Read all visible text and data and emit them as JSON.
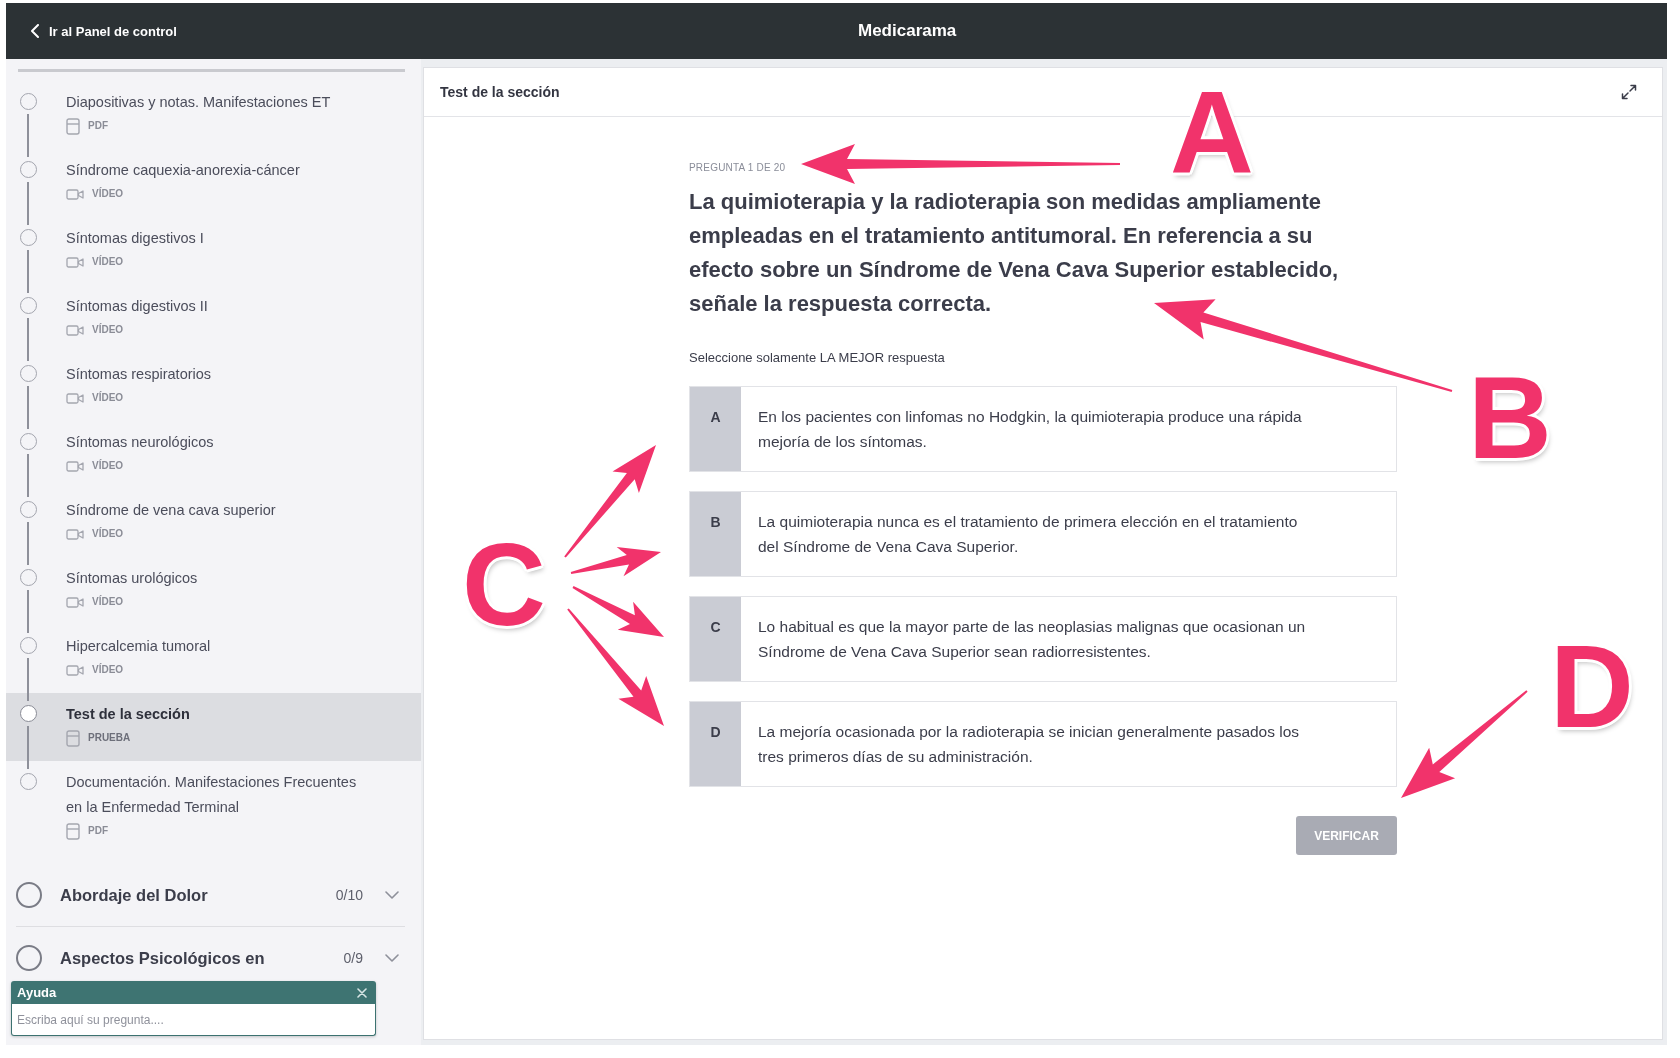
{
  "top_bar": {
    "back_link": "Ir al Panel de control",
    "title": "Medicarama"
  },
  "sidebar": {
    "items": [
      {
        "title": "Diapositivas y notas. Manifestaciones ET",
        "type_label": "PDF",
        "kind": "document",
        "selected": false
      },
      {
        "title": "Síndrome caquexia-anorexia-cáncer",
        "type_label": "VÍDEO",
        "kind": "video",
        "selected": false
      },
      {
        "title": "Síntomas digestivos I",
        "type_label": "VÍDEO",
        "kind": "video",
        "selected": false
      },
      {
        "title": "Síntomas digestivos II",
        "type_label": "VÍDEO",
        "kind": "video",
        "selected": false
      },
      {
        "title": "Síntomas respiratorios",
        "type_label": "VÍDEO",
        "kind": "video",
        "selected": false
      },
      {
        "title": "Síntomas neurológicos",
        "type_label": "VÍDEO",
        "kind": "video",
        "selected": false
      },
      {
        "title": "Síndrome de vena cava superior",
        "type_label": "VÍDEO",
        "kind": "video",
        "selected": false
      },
      {
        "title": "Síntomas urológicos",
        "type_label": "VÍDEO",
        "kind": "video",
        "selected": false
      },
      {
        "title": "Hipercalcemia tumoral",
        "type_label": "VÍDEO",
        "kind": "video",
        "selected": false
      },
      {
        "title": "Test de la sección",
        "type_label": "PRUEBA",
        "kind": "document",
        "selected": true
      },
      {
        "title": "Documentación. Manifestaciones Frecuentes en la Enfermedad Terminal",
        "type_label": "PDF",
        "kind": "document",
        "selected": false
      }
    ],
    "sections": [
      {
        "title": "Abordaje del Dolor",
        "count": "0/10",
        "expanded": false
      },
      {
        "title": "Aspectos Psicológicos en",
        "count": "0/9",
        "expanded": false
      }
    ]
  },
  "help_widget": {
    "title": "Ayuda",
    "placeholder": "Escriba aquí su pregunta...."
  },
  "panel": {
    "title": "Test de la sección",
    "question": {
      "progress": "PREGUNTA 1 DE 20",
      "text": "La quimioterapia y la radioterapia son medidas ampliamente empleadas en el tratamiento antitumoral. En referencia a su efecto sobre un Síndrome de Vena Cava Superior establecido, señale la respuesta correcta.",
      "instruction": "Seleccione solamente LA MEJOR respuesta",
      "options": [
        {
          "letter": "A",
          "text": "En los pacientes con linfomas no Hodgkin, la quimioterapia produce una rápida mejoría de los síntomas.",
          "selected": false
        },
        {
          "letter": "B",
          "text": "La quimioterapia nunca es el tratamiento de primera elección en el tratamiento del Síndrome de Vena Cava Superior.",
          "selected": false
        },
        {
          "letter": "C",
          "text": "Lo habitual es que la mayor parte de las neoplasias malignas que ocasionan un Síndrome de Vena Cava Superior sean radiorresistentes.",
          "selected": false
        },
        {
          "letter": "D",
          "text": "La mejoría ocasionada por la radioterapia se inician generalmente pasados los tres primeros días de su administración.",
          "selected": false
        }
      ],
      "verify_button": {
        "label": "VERIFICAR",
        "disabled": true
      }
    }
  },
  "annotations": [
    {
      "label": "A"
    },
    {
      "label": "B"
    },
    {
      "label": "C"
    },
    {
      "label": "D"
    }
  ]
}
